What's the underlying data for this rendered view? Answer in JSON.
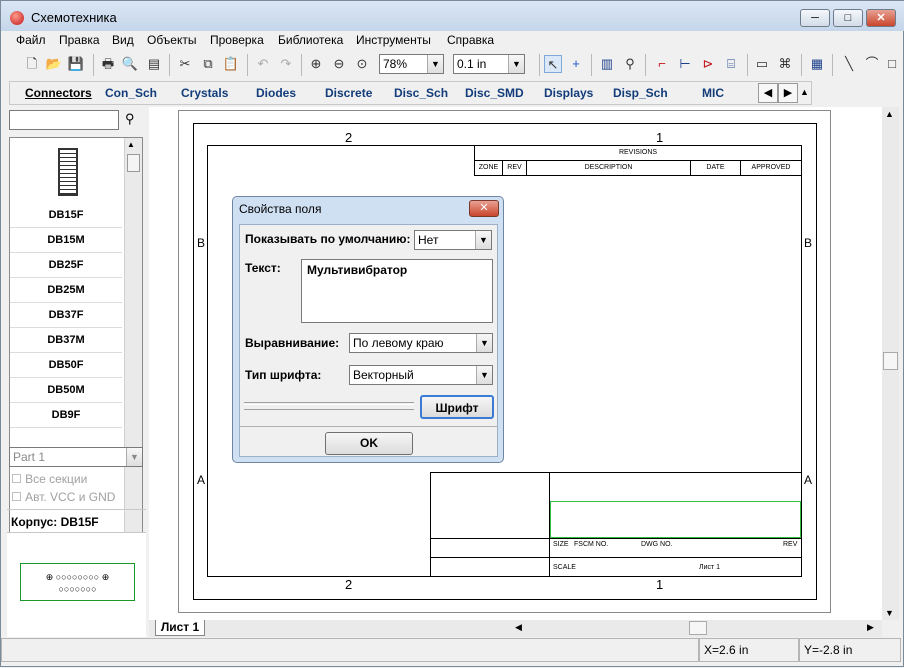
{
  "window": {
    "title": "Схемотехника",
    "min": "─",
    "max": "□",
    "close": "✕"
  },
  "menu": [
    "Файл",
    "Правка",
    "Вид",
    "Объекты",
    "Проверка",
    "Библиотека",
    "Инструменты",
    "Справка"
  ],
  "toolbar": {
    "zoom": "78%",
    "grid": "0.1 in"
  },
  "libtabs": [
    "Connectors",
    "Con_Sch",
    "Crystals",
    "Diodes",
    "Discrete",
    "Disc_Sch",
    "Disc_SMD",
    "Displays",
    "Disp_Sch",
    "MIC"
  ],
  "components": [
    "DB15F",
    "DB15M",
    "DB25F",
    "DB25M",
    "DB37F",
    "DB37M",
    "DB50F",
    "DB50M",
    "DB9F"
  ],
  "part_select": "Part 1",
  "check_all_sections": "Все секции",
  "check_vcc_gnd": "Авт. VCC и GND",
  "package_label": "Корпус: DB15F",
  "sheet": {
    "col2": "2",
    "col1": "1",
    "rowB": "B",
    "rowA": "A",
    "revisions": "REVISIONS",
    "zone": "ZONE",
    "rev": "REV",
    "description": "DESCRIPTION",
    "date": "DATE",
    "approved": "APPROVED",
    "size": "SIZE",
    "fscm": "FSCM NO.",
    "dwg": "DWG NO.",
    "rev2": "REV",
    "scale": "SCALE",
    "list": "Лист 1"
  },
  "sheet_tab": "Лист 1",
  "dialog": {
    "title": "Свойства поля",
    "show_default_label": "Показывать по умолчанию:",
    "show_default_value": "Нет",
    "text_label": "Текст:",
    "text_value": "Мультивибратор",
    "align_label": "Выравнивание:",
    "align_value": "По левому краю",
    "font_type_label": "Тип шрифта:",
    "font_type_value": "Векторный",
    "font_button": "Шрифт",
    "ok_button": "OK"
  },
  "status": {
    "x": "X=2.6 in",
    "y": "Y=-2.8 in"
  }
}
